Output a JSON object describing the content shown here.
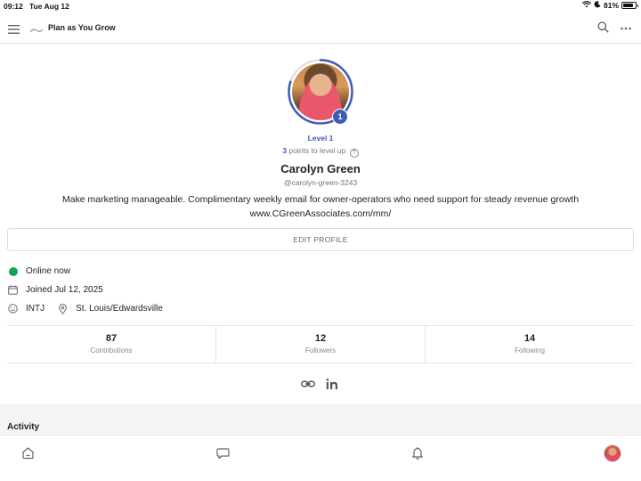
{
  "status_bar": {
    "time": "09:12",
    "date": "Tue Aug 12",
    "battery_percent": "81%",
    "battery_level": 0.81
  },
  "header": {
    "title": "Plan as You Grow",
    "icons": [
      "menu-icon",
      "logo",
      "search-icon",
      "more-icon"
    ]
  },
  "profile": {
    "level_label": "Level 1",
    "level_number": "1",
    "points_count": "3",
    "points_text": "points to level up",
    "level_progress": 0.8,
    "name": "Carolyn Green",
    "handle": "@carolyn-green-3243",
    "bio_line1": "Make marketing manageable. Complimentary weekly email for owner-operators who need support for steady revenue growth",
    "bio_line2": "www.CGreenAssociates.com/mm/",
    "edit_button": "EDIT PROFILE"
  },
  "info": {
    "online": "Online now",
    "joined": "Joined Jul 12, 2025",
    "personality": "INTJ",
    "location": "St. Louis/Edwardsville"
  },
  "stats": [
    {
      "value": "87",
      "label": "Contributions"
    },
    {
      "value": "12",
      "label": "Followers"
    },
    {
      "value": "14",
      "label": "Following"
    }
  ],
  "social": [
    "link-icon",
    "linkedin-icon"
  ],
  "activity": {
    "title": "Activity"
  },
  "tabbar": [
    "home-icon",
    "chat-icon",
    "bell-icon",
    "profile-avatar"
  ],
  "colors": {
    "accent": "#3f5bb5",
    "online": "#15a15a"
  }
}
